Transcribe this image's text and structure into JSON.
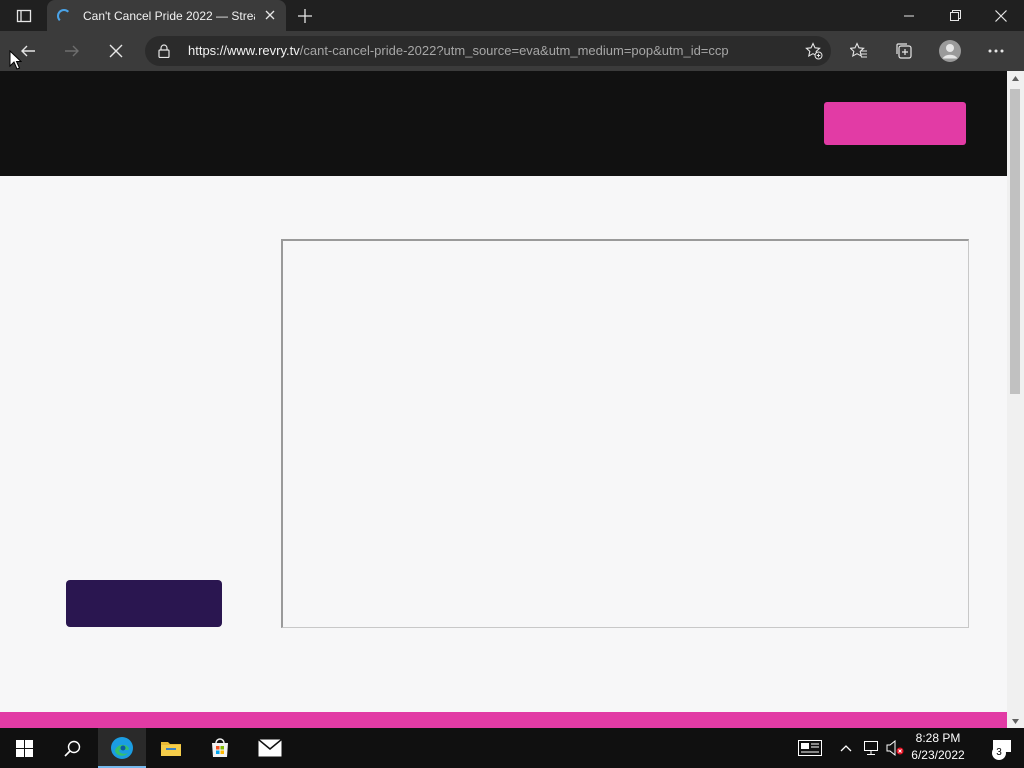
{
  "browser": {
    "tab": {
      "title": "Can't Cancel Pride 2022 — Strea",
      "loading": true
    },
    "address": {
      "scheme": "https://",
      "host": "www.revry.tv",
      "path": "/cant-cancel-pride-2022?utm_source=eva&utm_medium=pop&utm_id=ccp"
    }
  },
  "page": {
    "header_bg": "#111111",
    "accent_pink": "#e23ba5",
    "button_purple": "#2a1650"
  },
  "taskbar": {
    "time": "8:28 PM",
    "date": "6/23/2022",
    "notification_count": "3"
  },
  "icons": [
    "tab-actions-icon",
    "loading-spinner-icon",
    "close-tab-icon",
    "new-tab-icon",
    "minimize-icon",
    "restore-icon",
    "close-window-icon",
    "back-icon",
    "forward-icon",
    "stop-loading-icon",
    "lock-icon",
    "add-favorite-icon",
    "favorites-icon",
    "collections-icon",
    "profile-icon",
    "more-icon",
    "windows-start-icon",
    "search-icon",
    "edge-icon",
    "file-explorer-icon",
    "store-icon",
    "mail-icon",
    "news-icon",
    "show-hidden-icon",
    "network-icon",
    "volume-muted-icon",
    "notifications-icon",
    "mouse-cursor-icon"
  ]
}
